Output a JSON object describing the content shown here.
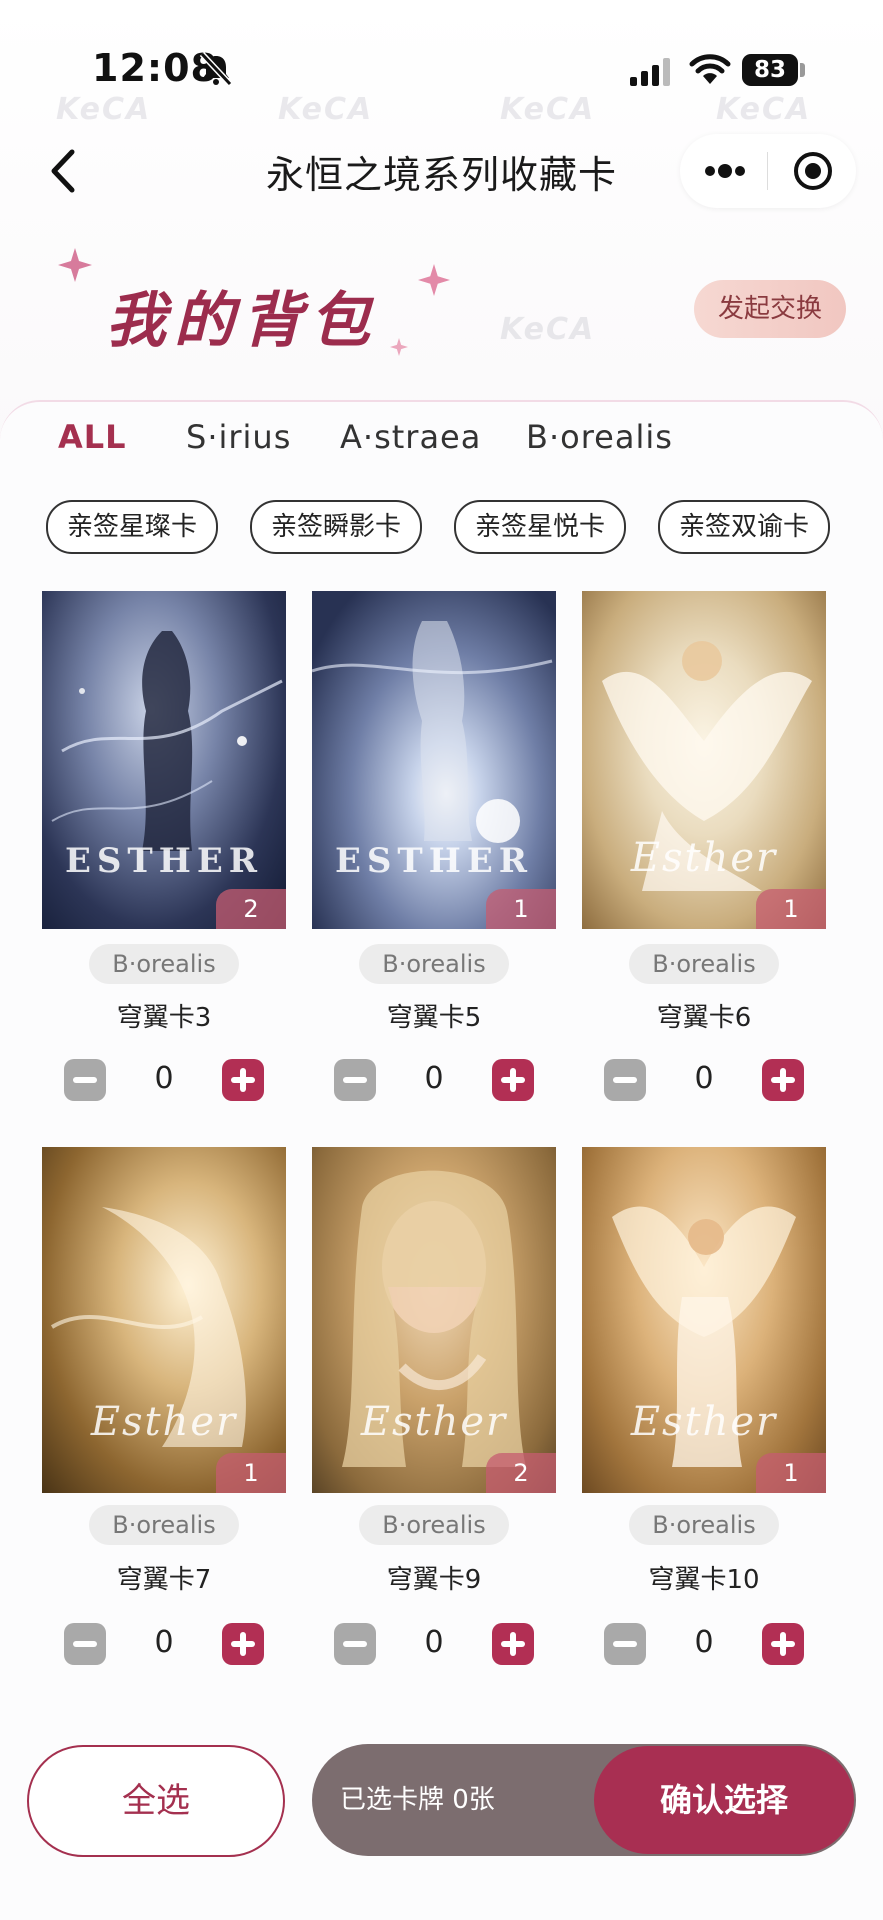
{
  "status_bar": {
    "time": "12:08",
    "battery": "83"
  },
  "nav": {
    "title": "永恒之境系列收藏卡"
  },
  "header": {
    "title": "我的背包",
    "exchange_label": "发起交换"
  },
  "tabs": [
    {
      "label": "ALL",
      "active": true
    },
    {
      "label": "S·irius",
      "active": false
    },
    {
      "label": "A·straea",
      "active": false
    },
    {
      "label": "B·orealis",
      "active": false
    }
  ],
  "chips": [
    "亲签星璨卡",
    "亲签瞬影卡",
    "亲签星悦卡",
    "亲签双谕卡"
  ],
  "cards": [
    {
      "series": "B·orealis",
      "name": "穹翼卡3",
      "owned": "2",
      "qty": "0",
      "caption": "ESTHER"
    },
    {
      "series": "B·orealis",
      "name": "穹翼卡5",
      "owned": "1",
      "qty": "0",
      "caption": "ESTHER"
    },
    {
      "series": "B·orealis",
      "name": "穹翼卡6",
      "owned": "1",
      "qty": "0",
      "caption": "Esther"
    },
    {
      "series": "B·orealis",
      "name": "穹翼卡7",
      "owned": "1",
      "qty": "0",
      "caption": "Esther"
    },
    {
      "series": "B·orealis",
      "name": "穹翼卡9",
      "owned": "2",
      "qty": "0",
      "caption": "Esther"
    },
    {
      "series": "B·orealis",
      "name": "穹翼卡10",
      "owned": "1",
      "qty": "0",
      "caption": "Esther"
    }
  ],
  "footer": {
    "select_all": "全选",
    "selected_summary": "已选卡牌 0张",
    "confirm": "确认选择"
  },
  "watermark": "KeCA",
  "colors": {
    "accent": "#a4304f",
    "plus": "#b22f54",
    "minus": "#a9a9a9",
    "summary_bg": "#7c6d6f"
  },
  "icons": [
    "mute-bell-icon",
    "signal-icon",
    "wifi-icon",
    "back-icon",
    "more-icon",
    "target-icon",
    "sparkle-icon",
    "minus-icon",
    "plus-icon"
  ]
}
